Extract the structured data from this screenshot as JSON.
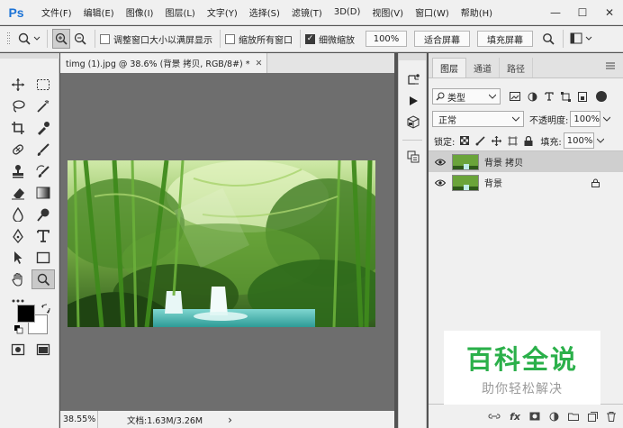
{
  "app": {
    "logo": "Ps"
  },
  "menu": [
    "文件(F)",
    "编辑(E)",
    "图像(I)",
    "图层(L)",
    "文字(Y)",
    "选择(S)",
    "滤镜(T)",
    "3D(D)",
    "视图(V)",
    "窗口(W)",
    "帮助(H)"
  ],
  "window_controls": {
    "minimize": "—",
    "maximize": "☐",
    "close": "✕"
  },
  "options": {
    "resize_windows": "调整窗口大小以满屏显示",
    "zoom_all_windows": "缩放所有窗口",
    "scrubby_zoom": "细微缩放",
    "zoom_value": "100%",
    "fit_screen": "适合屏幕",
    "fill_screen": "填充屏幕"
  },
  "document": {
    "tab_title": "timg (1).jpg @ 38.6% (背景 拷贝, RGB/8#) *",
    "close": "✕",
    "zoom": "38.55%",
    "doc_info": "文档:1.63M/3.26M",
    "arrow": "›"
  },
  "layers_panel": {
    "tabs": [
      "图层",
      "通道",
      "路径"
    ],
    "filter_kind": "类型",
    "blend_mode": "正常",
    "opacity_label": "不透明度:",
    "opacity_value": "100%",
    "lock_label": "锁定:",
    "fill_label": "填充:",
    "fill_value": "100%",
    "layers": [
      {
        "name": "背景 拷贝",
        "selected": true,
        "locked": false
      },
      {
        "name": "背景",
        "selected": false,
        "locked": true
      }
    ],
    "footer_fx": "fx"
  },
  "watermark": {
    "title": "百科全说",
    "subtitle": "助你轻松解决"
  },
  "colors": {
    "ps_blue": "#1c73d6",
    "watermark_green": "#2bb04a",
    "workspace": "#6e6e6e"
  }
}
